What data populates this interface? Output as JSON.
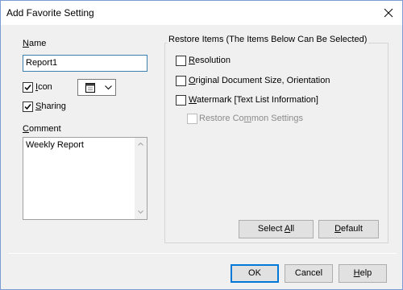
{
  "window": {
    "title": "Add Favorite Setting"
  },
  "name_section": {
    "label_accel": "N",
    "label_rest": "ame",
    "value": "Report1"
  },
  "icon_option": {
    "accel": "I",
    "rest": "con",
    "checked": true,
    "selected_icon": "memo-icon"
  },
  "sharing_option": {
    "accel": "S",
    "rest": "haring",
    "checked": true
  },
  "comment_section": {
    "label_accel": "C",
    "label_rest": "omment",
    "value": "Weekly Report"
  },
  "restore_group": {
    "title": "Restore Items (The Items Below Can Be Selected)",
    "items": [
      {
        "accel": "R",
        "rest": "esolution",
        "checked": false,
        "enabled": true
      },
      {
        "accel": "O",
        "rest": "riginal Document Size, Orientation",
        "checked": false,
        "enabled": true
      },
      {
        "accel": "W",
        "rest": "atermark [Text List Information]",
        "checked": false,
        "enabled": true
      },
      {
        "pre": "Restore Co",
        "accel": "m",
        "rest": "mon Settings",
        "checked": false,
        "enabled": false
      }
    ],
    "select_all": {
      "pre": "Select ",
      "accel": "A",
      "rest": "ll"
    },
    "default": {
      "accel": "D",
      "rest": "efault"
    }
  },
  "footer": {
    "ok": "OK",
    "cancel": "Cancel",
    "help": {
      "accel": "H",
      "rest": "elp"
    }
  }
}
